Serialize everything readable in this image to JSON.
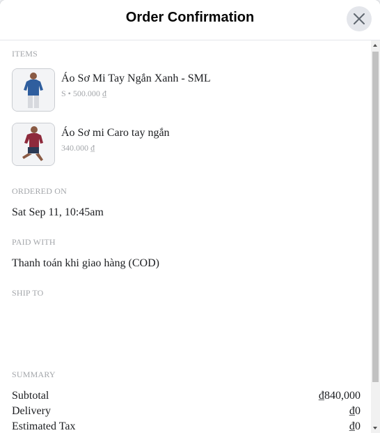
{
  "dialog": {
    "title": "Order Confirmation",
    "close_icon": "close-icon"
  },
  "items_section": {
    "label": "ITEMS",
    "items": [
      {
        "name": "Áo Sơ Mi Tay Ngắn Xanh - SML",
        "detail": "S • 500.000 ₫",
        "image": "blue-shirt-product-image"
      },
      {
        "name": "Áo Sơ mi Caro tay ngắn",
        "detail": "340.000 ₫",
        "image": "checkered-shirt-product-image"
      }
    ]
  },
  "ordered_on": {
    "label": "ORDERED ON",
    "value": "Sat Sep 11, 10:45am"
  },
  "paid_with": {
    "label": "PAID WITH",
    "value": "Thanh toán khi giao hàng (COD)"
  },
  "ship_to": {
    "label": "SHIP TO",
    "value": ""
  },
  "summary": {
    "label": "SUMMARY",
    "rows": [
      {
        "label": "Subtotal",
        "value": "₫840,000"
      },
      {
        "label": "Delivery",
        "value": "₫0"
      },
      {
        "label": "Estimated Tax",
        "value": "₫0"
      }
    ]
  },
  "colors": {
    "text": "#1c1e21",
    "muted": "#a3a6aa",
    "close_bg": "#e4e6eb"
  }
}
